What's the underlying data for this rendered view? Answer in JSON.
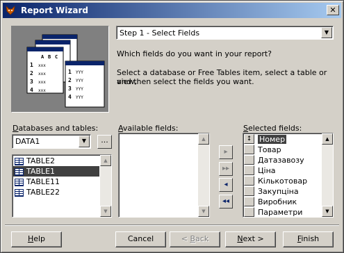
{
  "window": {
    "title": "Report Wizard",
    "close_symbol": "✕"
  },
  "header": {
    "step_select_value": "Step 1 - Select Fields",
    "question": "Which fields do you want in your report?",
    "instructions_line1": "Select a database or Free Tables item, select a table or view,",
    "instructions_line2": "and then select the fields you want."
  },
  "picture": {
    "sheet1": {
      "letters": [
        "A",
        "B",
        "C"
      ],
      "rows": [
        "1",
        "2",
        "3",
        "4"
      ],
      "cell_text": "xxx"
    },
    "sheet2": {
      "rows": [
        "1",
        "2",
        "3",
        "4"
      ],
      "cell_text": "YYY"
    }
  },
  "databases": {
    "label_underlined": "D",
    "label_rest": "atabases and tables:",
    "selected_db": "DATA1",
    "browse_label": "...",
    "tables": [
      "TABLE2",
      "TABLE1",
      "TABLE11",
      "TABLE22"
    ],
    "selected_table_index": 1
  },
  "available": {
    "label_underlined": "A",
    "label_rest": "vailable fields:",
    "fields": []
  },
  "mover": {
    "add_one": "▸",
    "add_all": "▸▸",
    "remove_one": "◂",
    "remove_all": "◂◂"
  },
  "selected": {
    "label_underlined": "S",
    "label_rest": "elected fields:",
    "fields": [
      "Номер",
      "Товар",
      "Датазавозу",
      "Ціна",
      "Кількотовар",
      "Закупціна",
      "Виробник",
      "Параметри"
    ],
    "selected_index": 0,
    "move_handle_symbol": "↕"
  },
  "buttons": {
    "help": {
      "u": "H",
      "rest": "elp"
    },
    "cancel": "Cancel",
    "back": {
      "pre": "< ",
      "u": "B",
      "rest": "ack"
    },
    "next": {
      "u": "N",
      "rest": "ext >"
    },
    "finish": {
      "u": "F",
      "rest": "inish"
    }
  },
  "colors": {
    "title_gradient_start": "#0a246a",
    "title_gradient_end": "#a6caf0",
    "selection": "#404040",
    "face": "#d4d0c8"
  }
}
